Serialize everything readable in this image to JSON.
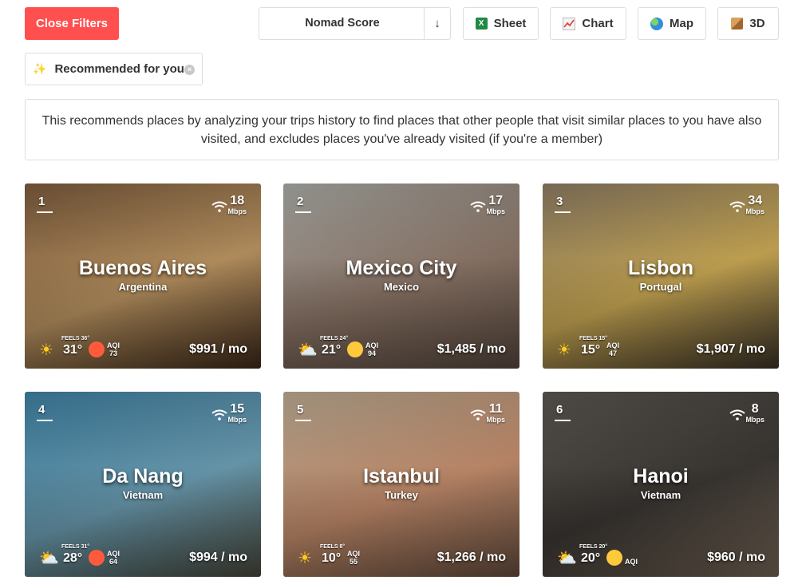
{
  "toolbar": {
    "close_filters": "Close Filters",
    "sort_label": "Nomad Score",
    "sort_arrow": "↓",
    "sheet": "Sheet",
    "chart": "Chart",
    "map": "Map",
    "threed": "3D",
    "sheet_icon_glyph": "X"
  },
  "filter_chip": {
    "icon": "✨",
    "label": "Recommended for you",
    "remove": "×"
  },
  "info_text": "This recommends places by analyzing your trips history to find places that other people that visit similar places to you have also visited, and excludes places you've already visited (if you're a member)",
  "colors": {
    "accent": "#ff4f4f",
    "border": "#dddddd",
    "aqi_bad": "#ff5a3c",
    "aqi_moderate": "#ffc93c"
  },
  "cards": [
    {
      "rank": "1",
      "speed": "18",
      "speed_unit": "Mbps",
      "city": "Buenos Aires",
      "country": "Argentina",
      "weather_icon": "☀",
      "feels": "FEELS 36°",
      "temp": "31°",
      "aqi_label": "AQI",
      "aqi": "73",
      "aqi_status": "bad",
      "price": "$991 / mo",
      "bg": [
        "#7a5a3c",
        "#b89260",
        "#3f2a1a"
      ]
    },
    {
      "rank": "2",
      "speed": "17",
      "speed_unit": "Mbps",
      "city": "Mexico City",
      "country": "Mexico",
      "weather_icon": "⛅",
      "feels": "FEELS 24°",
      "temp": "21°",
      "aqi_label": "AQI",
      "aqi": "94",
      "aqi_status": "moderate",
      "price": "$1,485 / mo",
      "bg": [
        "#a9a9a4",
        "#8a7466",
        "#5a4a40"
      ]
    },
    {
      "rank": "3",
      "speed": "34",
      "speed_unit": "Mbps",
      "city": "Lisbon",
      "country": "Portugal",
      "weather_icon": "☀",
      "feels": "FEELS 15°",
      "temp": "15°",
      "aqi_label": "AQI",
      "aqi": "47",
      "aqi_status": "good",
      "price": "$1,907 / mo",
      "bg": [
        "#8a7a62",
        "#c7a653",
        "#3c3428"
      ]
    },
    {
      "rank": "4",
      "speed": "15",
      "speed_unit": "Mbps",
      "city": "Da Nang",
      "country": "Vietnam",
      "weather_icon": "⛅",
      "feels": "FEELS 31°",
      "temp": "28°",
      "aqi_label": "AQI",
      "aqi": "64",
      "aqi_status": "bad",
      "price": "$994 / mo",
      "bg": [
        "#3e7fa0",
        "#6a9bb0",
        "#4a4a3c"
      ]
    },
    {
      "rank": "5",
      "speed": "11",
      "speed_unit": "Mbps",
      "city": "Istanbul",
      "country": "Turkey",
      "weather_icon": "☀",
      "feels": "FEELS 8°",
      "temp": "10°",
      "aqi_label": "AQI",
      "aqi": "55",
      "aqi_status": "good",
      "price": "$1,266 / mo",
      "bg": [
        "#b9a890",
        "#c08a6a",
        "#6a5040"
      ]
    },
    {
      "rank": "6",
      "speed": "8",
      "speed_unit": "Mbps",
      "city": "Hanoi",
      "country": "Vietnam",
      "weather_icon": "⛅",
      "feels": "FEELS 20°",
      "temp": "20°",
      "aqi_label": "AQI",
      "aqi": "",
      "aqi_status": "moderate",
      "price": "$960 / mo",
      "bg": [
        "#5a5650",
        "#3a3632",
        "#7a6a5a"
      ]
    }
  ]
}
